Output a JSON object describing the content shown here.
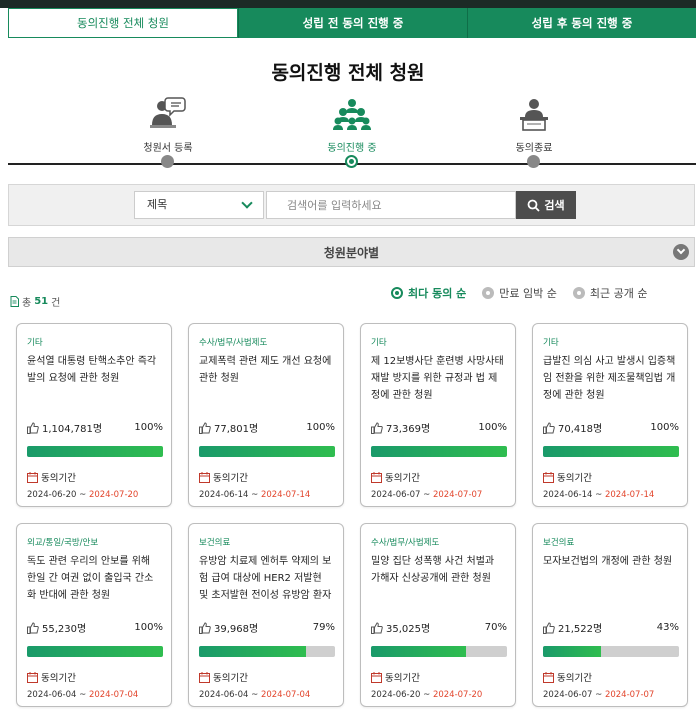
{
  "tabs": [
    {
      "label": "동의진행 전체 청원",
      "active": true
    },
    {
      "label": "성립 전 동의 진행 중",
      "active": false
    },
    {
      "label": "성립 후 동의 진행 중",
      "active": false
    }
  ],
  "page_title": "동의진행 전체 청원",
  "steps": [
    {
      "label": "청원서 등록",
      "icon": "petition-register-icon",
      "active": false
    },
    {
      "label": "동의진행 중",
      "icon": "people-group-icon",
      "active": true
    },
    {
      "label": "동의종료",
      "icon": "person-desk-icon",
      "active": false
    }
  ],
  "search": {
    "select_value": "제목",
    "placeholder": "검색어를 입력하세요",
    "button_label": "검색"
  },
  "category_bar": {
    "label": "청원분야별"
  },
  "total": {
    "prefix": "총",
    "count": "51",
    "suffix": "건"
  },
  "sorts": [
    {
      "label": "최다 동의 순",
      "active": true
    },
    {
      "label": "만료 임박 순",
      "active": false
    },
    {
      "label": "최근 공개 순",
      "active": false
    }
  ],
  "period_label": "동의기간",
  "cards": [
    {
      "category": "기타",
      "title": "윤석열 대통령 탄핵소추안 즉각 발의 요청에 관한 청원",
      "count": "1,104,781명",
      "percent_label": "100%",
      "progress": 1.0,
      "start": "2024-06-20",
      "sep": " ~ ",
      "end": "2024-07-20"
    },
    {
      "category": "수사/법무/사법제도",
      "title": "교제폭력 관련 제도 개선 요청에 관한 청원",
      "count": "77,801명",
      "percent_label": "100%",
      "progress": 1.0,
      "start": "2024-06-14",
      "sep": " ~ ",
      "end": "2024-07-14"
    },
    {
      "category": "기타",
      "title": "제 12보병사단 훈련병 사망사태 재발 방지를 위한 규정과 법 제정에 관한 청원",
      "count": "73,369명",
      "percent_label": "100%",
      "progress": 1.0,
      "start": "2024-06-07",
      "sep": " ~ ",
      "end": "2024-07-07"
    },
    {
      "category": "기타",
      "title": "급발진 의심 사고 발생시 입증책임 전환을 위한 제조물책임법 개정에 관한 청원",
      "count": "70,418명",
      "percent_label": "100%",
      "progress": 1.0,
      "start": "2024-06-14",
      "sep": " ~ ",
      "end": "2024-07-14"
    },
    {
      "category": "외교/통일/국방/안보",
      "title": "독도 관련 우리의 안보를 위해 한일 간 여권 없이 출입국 간소화 반대에 관한 청원",
      "count": "55,230명",
      "percent_label": "100%",
      "progress": 1.0,
      "start": "2024-06-04",
      "sep": " ~ ",
      "end": "2024-07-04"
    },
    {
      "category": "보건의료",
      "title": "유방암 치료제 엔허투 약제의 보험 급여 대상에 HER2 저발현 및 초저발현 전이성 유방암 환자가",
      "count": "39,968명",
      "percent_label": "79%",
      "progress": 0.79,
      "start": "2024-06-04",
      "sep": " ~ ",
      "end": "2024-07-04"
    },
    {
      "category": "수사/법무/사법제도",
      "title": "밀양 집단 성폭행 사건 처벌과 가해자 신상공개에 관한 청원",
      "count": "35,025명",
      "percent_label": "70%",
      "progress": 0.7,
      "start": "2024-06-20",
      "sep": " ~ ",
      "end": "2024-07-20"
    },
    {
      "category": "보건의료",
      "title": "모자보건법의 개정에 관한 청원",
      "count": "21,522명",
      "percent_label": "43%",
      "progress": 0.43,
      "start": "2024-06-07",
      "sep": " ~ ",
      "end": "2024-07-07"
    }
  ]
}
